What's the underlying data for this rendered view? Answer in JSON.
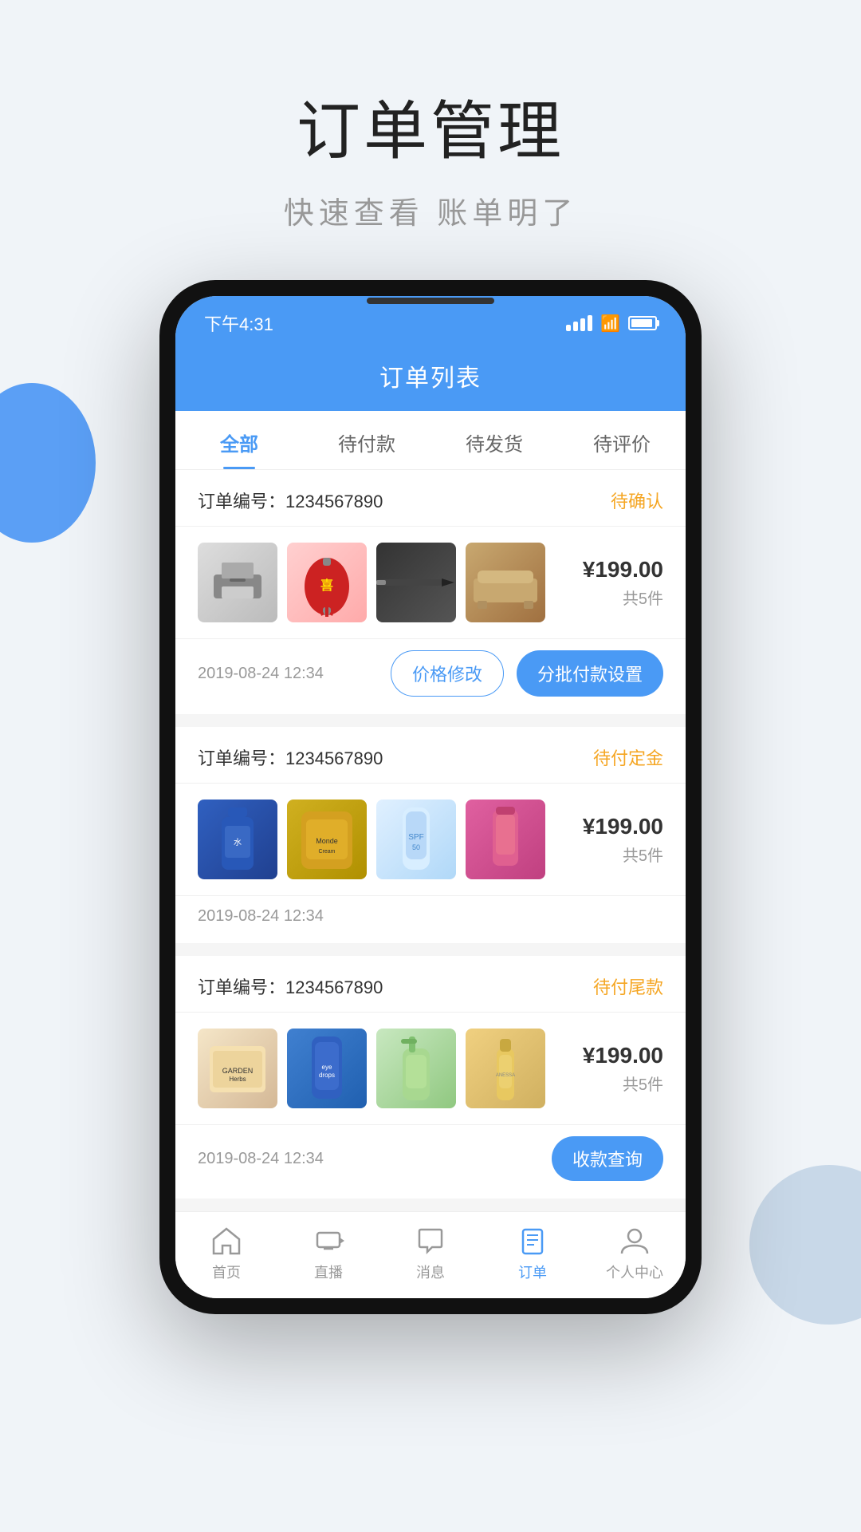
{
  "page": {
    "title": "订单管理",
    "subtitle": "快速查看 账单明了"
  },
  "status_bar": {
    "time": "下午4:31",
    "signal": "signal",
    "wifi": "wifi",
    "battery": "battery"
  },
  "app_header": {
    "title": "订单列表"
  },
  "tabs": [
    {
      "label": "全部",
      "active": true
    },
    {
      "label": "待付款",
      "active": false
    },
    {
      "label": "待发货",
      "active": false
    },
    {
      "label": "待评价",
      "active": false
    }
  ],
  "orders": [
    {
      "id": "order-1",
      "number_label": "订单编号：",
      "number": "1234567890",
      "status": "待确认",
      "price": "¥199.00",
      "count": "共5件",
      "date": "2019-08-24 12:34",
      "actions": [
        {
          "label": "价格修改",
          "type": "outline"
        },
        {
          "label": "分批付款设置",
          "type": "solid"
        }
      ],
      "products": [
        {
          "id": "p1",
          "color_class": "product-img-1"
        },
        {
          "id": "p2",
          "color_class": "product-img-2"
        },
        {
          "id": "p3",
          "color_class": "product-img-3"
        },
        {
          "id": "p4",
          "color_class": "product-img-4"
        }
      ]
    },
    {
      "id": "order-2",
      "number_label": "订单编号：",
      "number": "1234567890",
      "status": "待付定金",
      "price": "¥199.00",
      "count": "共5件",
      "date": "2019-08-24 12:34",
      "actions": [],
      "products": [
        {
          "id": "p5",
          "color_class": "product-img-5"
        },
        {
          "id": "p6",
          "color_class": "product-img-6"
        },
        {
          "id": "p7",
          "color_class": "product-img-7"
        },
        {
          "id": "p8",
          "color_class": "product-img-8"
        }
      ]
    },
    {
      "id": "order-3",
      "number_label": "订单编号：",
      "number": "1234567890",
      "status": "待付尾款",
      "price": "¥199.00",
      "count": "共5件",
      "date": "2019-08-24 12:34",
      "actions": [
        {
          "label": "收款查询",
          "type": "solid"
        }
      ],
      "products": [
        {
          "id": "p9",
          "color_class": "product-img-9"
        },
        {
          "id": "p10",
          "color_class": "product-img-10"
        },
        {
          "id": "p11",
          "color_class": "product-img-11"
        },
        {
          "id": "p12",
          "color_class": "product-img-12"
        }
      ]
    }
  ],
  "nav": [
    {
      "id": "nav-home",
      "label": "首页",
      "icon": "home",
      "active": false
    },
    {
      "id": "nav-live",
      "label": "直播",
      "icon": "live",
      "active": false
    },
    {
      "id": "nav-message",
      "label": "消息",
      "icon": "message",
      "active": false
    },
    {
      "id": "nav-order",
      "label": "订单",
      "icon": "order",
      "active": true
    },
    {
      "id": "nav-profile",
      "label": "个人中心",
      "icon": "profile",
      "active": false
    }
  ]
}
